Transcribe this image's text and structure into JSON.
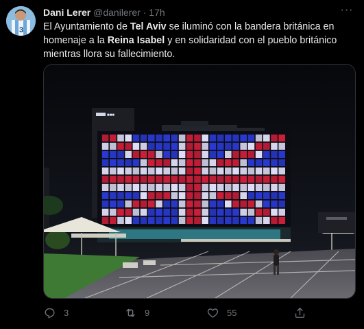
{
  "tweet": {
    "author": {
      "display_name": "Dani Lerer",
      "handle": "@danilerer",
      "separator": "·",
      "time": "17h"
    },
    "text": {
      "p1": "El Ayuntamiento de ",
      "b1": "Tel Aviv",
      "p2": " se iluminó con la bandera británica en homenaje a la ",
      "b2": "Reina Isabel",
      "p3": " y en solidaridad con el pueblo británico mientras llora su fallecimiento."
    },
    "media": {
      "alt": "Tel Aviv City Hall illuminated with the British flag at night",
      "building_sign": "■■■"
    },
    "actions": {
      "reply_count": "3",
      "retweet_count": "9",
      "like_count": "55"
    }
  },
  "colors": {
    "background": "#000000",
    "text": "#e7e9ea",
    "secondary": "#71767b",
    "flag_red": "#d3203a",
    "flag_blue": "#2b3bd8",
    "flag_white": "#e8e6ff"
  },
  "icons": [
    "more-icon",
    "reply-icon",
    "retweet-icon",
    "like-icon",
    "share-icon"
  ]
}
